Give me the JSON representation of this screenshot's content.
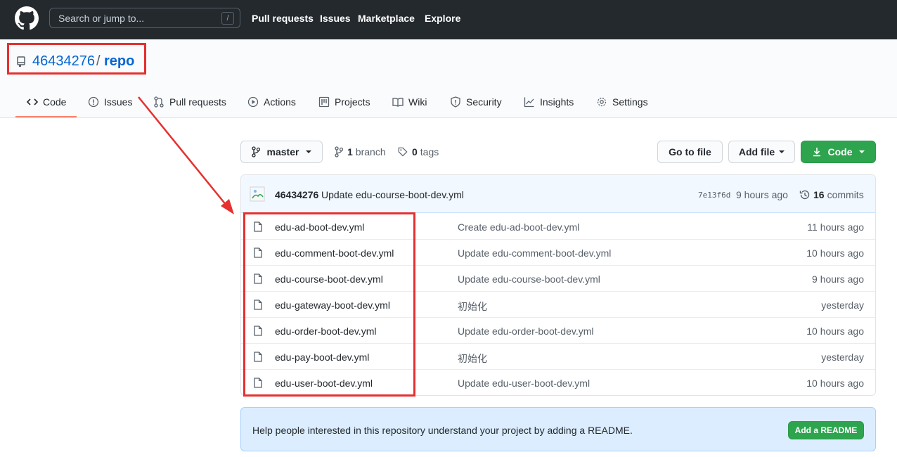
{
  "header": {
    "search_placeholder": "Search or jump to...",
    "search_shortcut": "/",
    "nav": [
      "Pull requests",
      "Issues",
      "Marketplace",
      "Explore"
    ]
  },
  "repo": {
    "owner": "46434276",
    "separator": "/",
    "name": "repo"
  },
  "tabs": [
    {
      "label": "Code",
      "icon": "code-icon"
    },
    {
      "label": "Issues",
      "icon": "issue-icon"
    },
    {
      "label": "Pull requests",
      "icon": "pull-request-icon"
    },
    {
      "label": "Actions",
      "icon": "play-icon"
    },
    {
      "label": "Projects",
      "icon": "project-icon"
    },
    {
      "label": "Wiki",
      "icon": "book-icon"
    },
    {
      "label": "Security",
      "icon": "shield-icon"
    },
    {
      "label": "Insights",
      "icon": "graph-icon"
    },
    {
      "label": "Settings",
      "icon": "gear-icon"
    }
  ],
  "toolbar": {
    "branch": "master",
    "branch_count": "1",
    "branch_label": "branch",
    "tag_count": "0",
    "tag_label": "tags",
    "go_to_file": "Go to file",
    "add_file": "Add file",
    "code": "Code"
  },
  "commit": {
    "author": "46434276",
    "message": "Update edu-course-boot-dev.yml",
    "sha": "7e13f6d",
    "time": "9 hours ago",
    "count": "16",
    "count_label": "commits"
  },
  "files": [
    {
      "name": "edu-ad-boot-dev.yml",
      "message": "Create edu-ad-boot-dev.yml",
      "time": "11 hours ago"
    },
    {
      "name": "edu-comment-boot-dev.yml",
      "message": "Update edu-comment-boot-dev.yml",
      "time": "10 hours ago"
    },
    {
      "name": "edu-course-boot-dev.yml",
      "message": "Update edu-course-boot-dev.yml",
      "time": "9 hours ago"
    },
    {
      "name": "edu-gateway-boot-dev.yml",
      "message": "初始化",
      "time": "yesterday"
    },
    {
      "name": "edu-order-boot-dev.yml",
      "message": "Update edu-order-boot-dev.yml",
      "time": "10 hours ago"
    },
    {
      "name": "edu-pay-boot-dev.yml",
      "message": "初始化",
      "time": "yesterday"
    },
    {
      "name": "edu-user-boot-dev.yml",
      "message": "Update edu-user-boot-dev.yml",
      "time": "10 hours ago"
    }
  ],
  "readme": {
    "text": "Help people interested in this repository understand your project by adding a README.",
    "button": "Add a README"
  },
  "colors": {
    "accent": "#0366d6",
    "annotation": "#e5302f",
    "primary_button": "#2ea44f"
  }
}
